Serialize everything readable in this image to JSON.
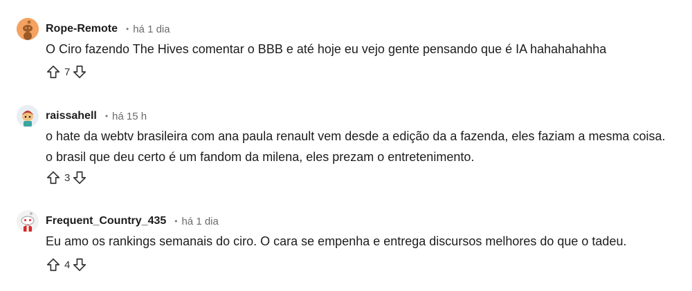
{
  "comments": [
    {
      "username": "Rope-Remote",
      "separator": "•",
      "time": "há 1 dia",
      "avatar_icon": "snoo-avatar-orange",
      "body": "O Ciro fazendo The Hives comentar o BBB e até hoje eu vejo gente pensando que é IA hahahahahha",
      "votes": "7"
    },
    {
      "username": "raissahell",
      "separator": "•",
      "time": "há 15 h",
      "avatar_icon": "snoo-avatar-custom",
      "body": "o hate da webtv brasileira com ana paula renault vem desde a edição da a fazenda, eles faziam a mesma coisa. o brasil que deu certo é um fandom da milena, eles prezam o entretenimento.",
      "votes": "3"
    },
    {
      "username": "Frequent_Country_435",
      "separator": "•",
      "time": "há 1 dia",
      "avatar_icon": "snoo-avatar-default",
      "body": "Eu amo os rankings semanais do ciro. O cara se empenha e entrega discursos melhores do que o tadeu.",
      "votes": "4"
    }
  ],
  "icons": {
    "upvote": "upvote-arrow-icon",
    "downvote": "downvote-arrow-icon"
  },
  "colors": {
    "avatar_orange": "#f4a261",
    "text": "#1c1c1c",
    "muted": "#6a6a6a"
  }
}
